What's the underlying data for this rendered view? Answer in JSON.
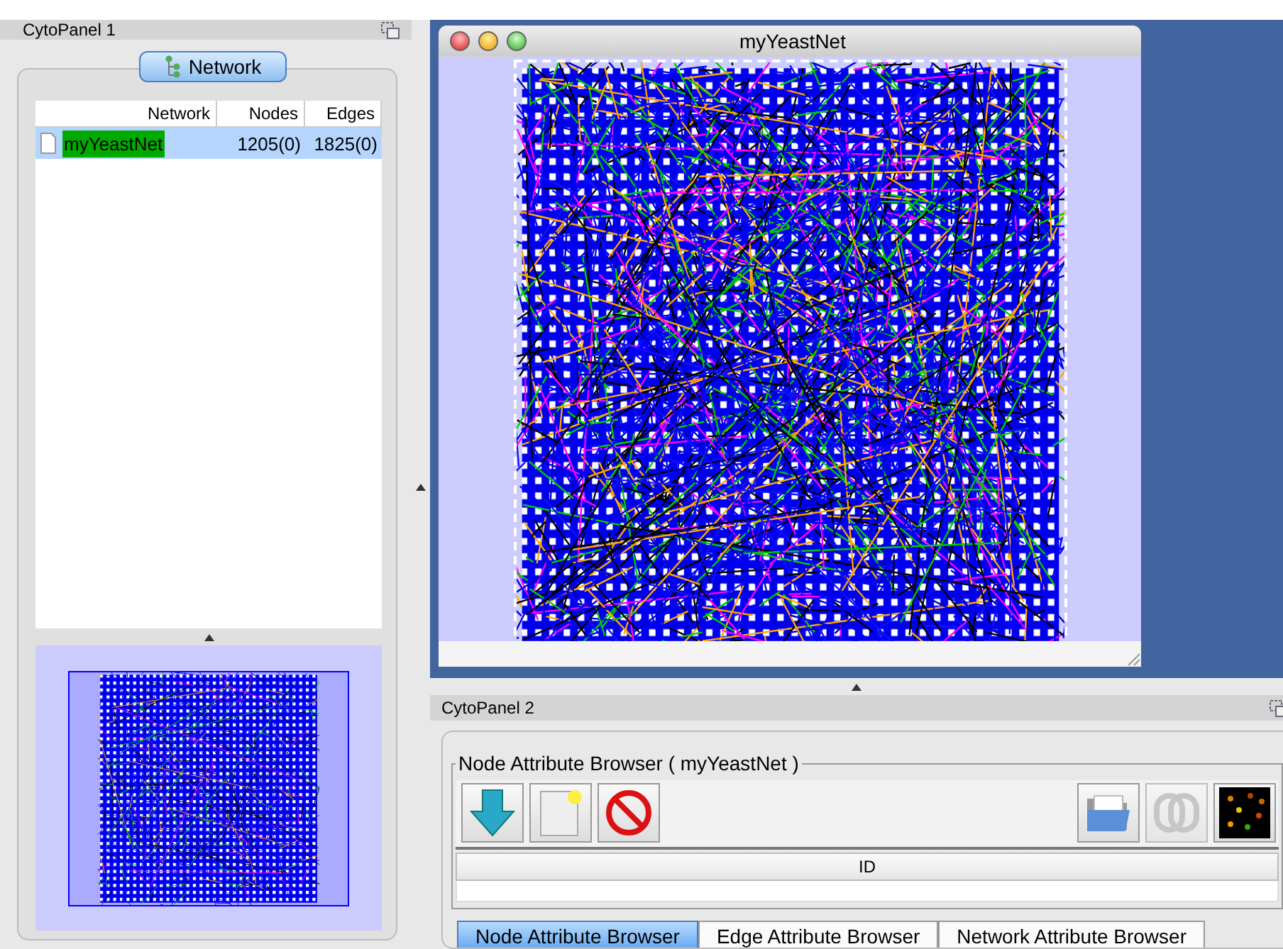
{
  "left_panel": {
    "title": "CytoPanel 1",
    "tab": {
      "label": "Network",
      "selected": true
    },
    "table": {
      "columns": [
        "Network",
        "Nodes",
        "Edges"
      ],
      "rows": [
        {
          "name": "myYeastNet",
          "nodes": "1205(0)",
          "edges": "1825(0)",
          "selected": true
        }
      ]
    }
  },
  "network_window": {
    "title": "myYeastNet"
  },
  "bottom_panel": {
    "title": "CytoPanel 2",
    "browser_title": "Node Attribute Browser ( myYeastNet )",
    "toolbar_left": [
      {
        "kind": "import",
        "disabled": false
      },
      {
        "kind": "new",
        "disabled": false
      },
      {
        "kind": "delete",
        "disabled": false
      }
    ],
    "toolbar_right": [
      {
        "kind": "open",
        "disabled": false
      },
      {
        "kind": "link",
        "disabled": true
      },
      {
        "kind": "heatmap",
        "disabled": false
      }
    ],
    "columns": [
      "ID"
    ],
    "tabs": [
      {
        "label": "Node Attribute Browser",
        "selected": true
      },
      {
        "label": "Edge Attribute Browser",
        "selected": false
      },
      {
        "label": "Network Attribute Browser",
        "selected": false
      }
    ]
  }
}
